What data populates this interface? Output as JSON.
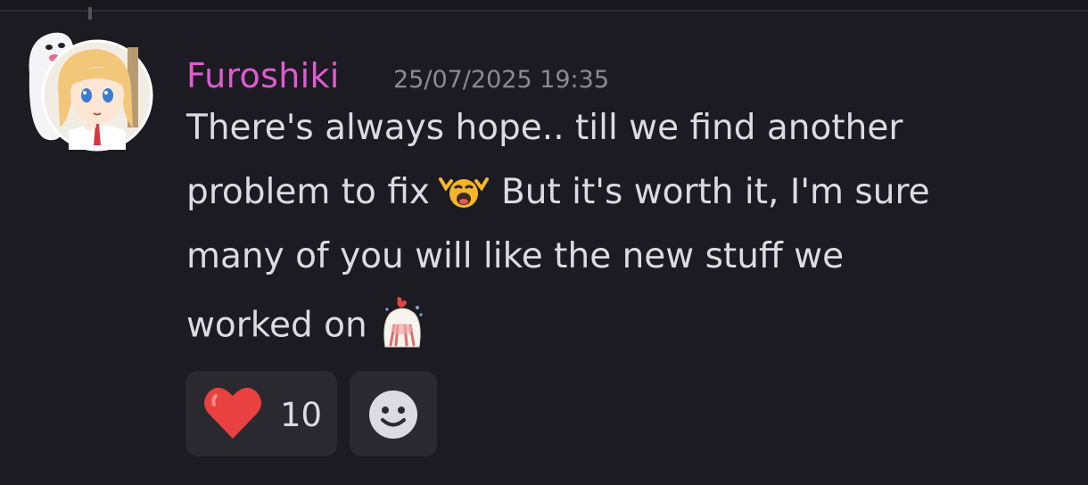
{
  "message": {
    "username": "Furoshiki",
    "timestamp": "25/07/2025 19:35",
    "lines": [
      "There's always hope.. till we find another",
      "problem to fix",
      "But it's worth it, I'm sure",
      "many of you will like the new stuff we",
      "worked on"
    ],
    "inline_emojis": [
      "crying-emoji",
      "ghost-blush-emoji"
    ]
  },
  "reactions": [
    {
      "icon": "heart-icon",
      "count": "10"
    }
  ],
  "add_reaction": {
    "icon": "smiley-icon"
  },
  "colors": {
    "background": "#1c1b22",
    "username": "#e05bd0",
    "text": "#dcdbe0",
    "timestamp": "#8c8b93",
    "reaction_bg": "#2a2930",
    "heart": "#e8413f"
  }
}
